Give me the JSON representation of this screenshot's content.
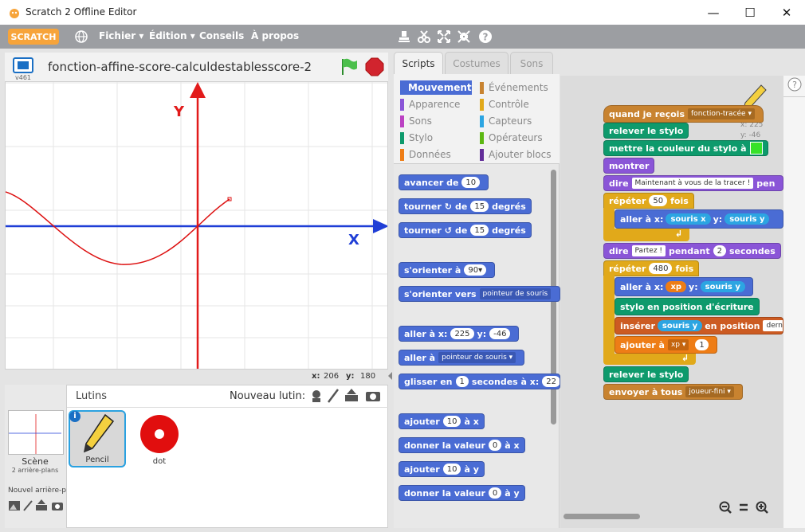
{
  "window": {
    "title": "Scratch 2 Offline Editor",
    "minimize": "—",
    "maximize": "☐",
    "close": "✕"
  },
  "menubar": {
    "logo": "SCRATCH",
    "file": "Fichier ▾",
    "edit": "Édition ▾",
    "tips": "Conseils",
    "about": "À propos"
  },
  "stage": {
    "version": "v461",
    "project_title": "fonction-affine-score-calculdestablesscore-2",
    "axis_y_label": "Y",
    "axis_x_label": "X",
    "mouse_x_label": "x:",
    "mouse_x": "206",
    "mouse_y_label": "y:",
    "mouse_y": "180"
  },
  "sprites": {
    "header": "Lutins",
    "new_sprite": "Nouveau lutin:",
    "scene_label": "Scène",
    "scene_sub": "2 arrière-plans",
    "new_backdrop": "Nouvel arrière-p",
    "items": [
      {
        "name": "Pencil"
      },
      {
        "name": "dot"
      }
    ]
  },
  "tabs": {
    "scripts": "Scripts",
    "costumes": "Costumes",
    "sounds": "Sons"
  },
  "categories": [
    {
      "label": "Mouvement",
      "color": "#4a6cd4"
    },
    {
      "label": "Événements",
      "color": "#c88330"
    },
    {
      "label": "Apparence",
      "color": "#8a55d7"
    },
    {
      "label": "Contrôle",
      "color": "#e1a91a"
    },
    {
      "label": "Sons",
      "color": "#bb42c3"
    },
    {
      "label": "Capteurs",
      "color": "#2ca5e2"
    },
    {
      "label": "Stylo",
      "color": "#0e9a6c"
    },
    {
      "label": "Opérateurs",
      "color": "#5cb712"
    },
    {
      "label": "Données",
      "color": "#ee7d16"
    },
    {
      "label": "Ajouter blocs",
      "color": "#632d99"
    }
  ],
  "palette": {
    "move": "avancer de",
    "move_val": "10",
    "turn": "tourner",
    "turn_of": "de",
    "turn_val": "15",
    "degrees": "degrés",
    "point": "s'orienter à",
    "point_val": "90▾",
    "point_towards": "s'orienter vers",
    "towards_val": "pointeur de souris",
    "goto": "aller à x:",
    "goto_x": "225",
    "goto_y_label": "y:",
    "goto_y": "-46",
    "goto2": "aller à",
    "goto2_val": "pointeur de souris ▾",
    "glide": "glisser en",
    "glide_val": "1",
    "glide_sec": "secondes à x:",
    "glide_x": "22",
    "change_x": "ajouter",
    "change_x_val": "10",
    "change_x_to": "à x",
    "set_x": "donner la valeur",
    "set_x_val": "0",
    "set_x_to": "à x",
    "change_y": "ajouter",
    "change_y_val": "10",
    "change_y_to": "à y",
    "set_y": "donner la valeur",
    "set_y_val": "0",
    "set_y_to": "à y"
  },
  "script": {
    "hat": "quand je reçois",
    "hat_msg": "fonction-tracée ▾",
    "xy_x": "x: 225",
    "xy_y": "y: -46",
    "pen_up": "relever le stylo",
    "set_color": "mettre la couleur du stylo à",
    "show": "montrer",
    "say": "dire",
    "say_text": "Maintenant à vous de la tracer !",
    "say_tail": "pen",
    "repeat1": "répéter",
    "repeat1_val": "50",
    "times": "fois",
    "goto_x": "aller à x:",
    "mouse_x": "souris x",
    "y_label": "y:",
    "mouse_y": "souris y",
    "say2": "dire",
    "say2_text": "Partez !",
    "say2_for": "pendant",
    "say2_val": "2",
    "say2_sec": "secondes",
    "repeat2": "répéter",
    "repeat2_val": "480",
    "times2": "fois",
    "goto2_x": "aller à x:",
    "xp": "xp",
    "y2_label": "y:",
    "mouse_y2": "souris y",
    "pen_down": "stylo en position d'écriture",
    "insert": "insérer",
    "insert_val": "souris y",
    "insert_at": "en position",
    "insert_pos": "dern",
    "change": "ajouter à",
    "change_var": "xp ▾",
    "change_val": "1",
    "pen_up2": "relever le stylo",
    "broadcast": "envoyer à tous",
    "broadcast_msg": "joueur-fini ▾"
  }
}
